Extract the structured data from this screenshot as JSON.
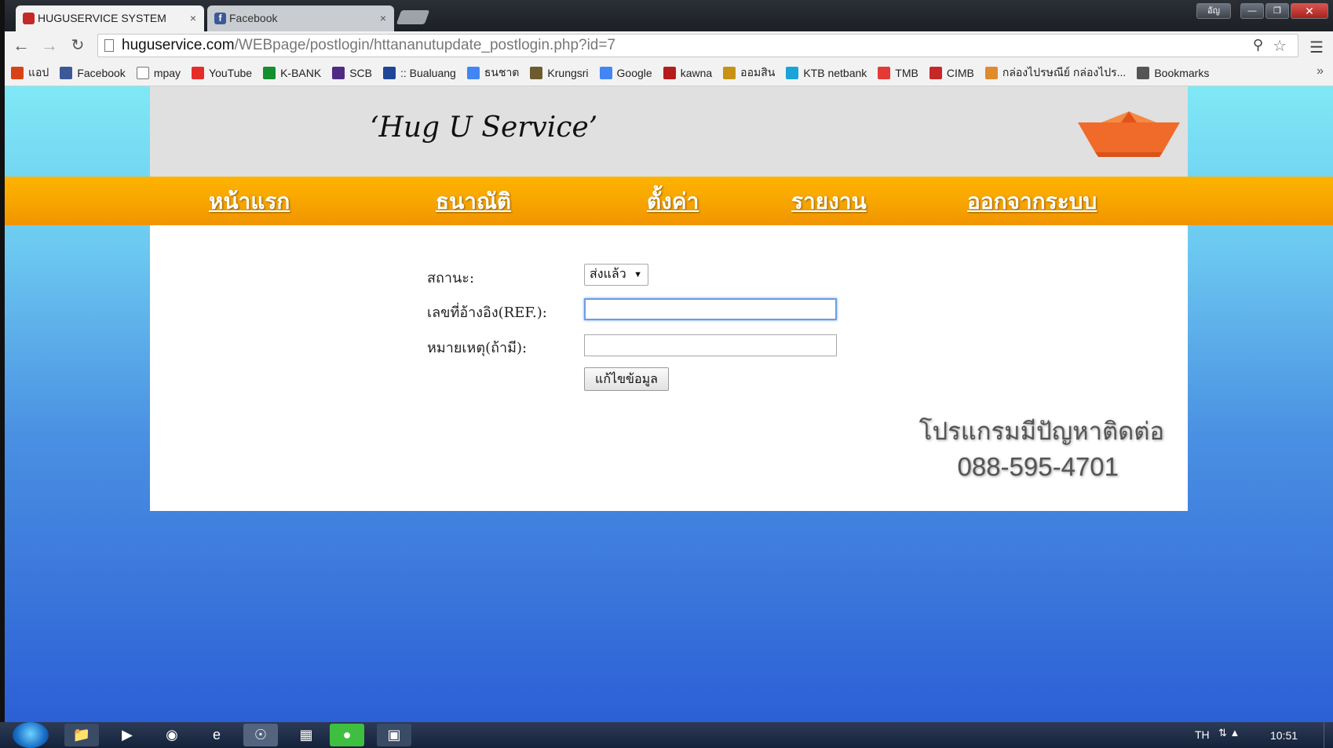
{
  "browser": {
    "tabs": [
      {
        "label": "HUGUSERVICE SYSTEM",
        "active": true
      },
      {
        "label": "Facebook",
        "active": false
      }
    ],
    "tab_close_glyph": "×",
    "window_buttons": {
      "profile": "อัญ",
      "minimize": "—",
      "maximize": "❐",
      "close": "✕"
    },
    "url_domain": "huguservice.com",
    "url_path": "/WEBpage/postlogin/httananutupdate_postlogin.php?id=7",
    "nav": {
      "back": "←",
      "forward": "→",
      "reload": "↻"
    },
    "bookmarks": [
      {
        "label": "แอป",
        "icon": "apps-icon",
        "color": "#d84315"
      },
      {
        "label": "Facebook",
        "icon": "facebook-icon",
        "color": "#3b5998"
      },
      {
        "label": "mpay",
        "icon": "page-icon",
        "color": "#ffffff"
      },
      {
        "label": "YouTube",
        "icon": "youtube-icon",
        "color": "#e52d27"
      },
      {
        "label": "K-BANK",
        "icon": "kbank-icon",
        "color": "#138f2d"
      },
      {
        "label": "SCB",
        "icon": "scb-icon",
        "color": "#4e2a84"
      },
      {
        "label": ":: Bualuang",
        "icon": "bualuang-icon",
        "color": "#1e4598"
      },
      {
        "label": "ธนชาต",
        "icon": "google-icon",
        "color": "#4285f4"
      },
      {
        "label": "Krungsri",
        "icon": "krungsri-icon",
        "color": "#6d5b2f"
      },
      {
        "label": "Google",
        "icon": "google-icon",
        "color": "#4285f4"
      },
      {
        "label": "kawna",
        "icon": "kawna-icon",
        "color": "#b71c1c"
      },
      {
        "label": "ออมสิน",
        "icon": "gsb-icon",
        "color": "#c69214"
      },
      {
        "label": "KTB netbank",
        "icon": "ktb-icon",
        "color": "#1aa3d9"
      },
      {
        "label": "TMB",
        "icon": "tmb-icon",
        "color": "#e53935"
      },
      {
        "label": "CIMB",
        "icon": "cimb-icon",
        "color": "#c62828"
      },
      {
        "label": "กล่องไปรษณีย์ กล่องไปร...",
        "icon": "box-icon",
        "color": "#e08a2c"
      },
      {
        "label": "Bookmarks",
        "icon": "star-icon",
        "color": "#555555"
      }
    ],
    "bookmarks_more": "»"
  },
  "site": {
    "title": "‘Hug U Service’",
    "nav": [
      "หน้าแรก",
      "ธนาณัติ",
      "ตั้งค่า",
      "รายงาน",
      "ออกจากระบบ"
    ],
    "form": {
      "status_label": "สถานะ:",
      "status_value": "ส่งแล้ว",
      "ref_label": "เลขที่อ้างอิง(REF.):",
      "ref_value": "",
      "note_label": "หมายเหตุ(ถ้ามี):",
      "note_value": "",
      "submit_label": "แก้ไขข้อมูล"
    },
    "help_text": "โปรแกรมมีปัญหาติดต่อ",
    "help_phone": "088-595-4701"
  },
  "taskbar": {
    "language": "TH",
    "time": "10:51"
  },
  "colors": {
    "nav_bar": "#f7a600",
    "banner": "#e0e0e0",
    "bg_top": "#7fe8f5",
    "bg_bottom": "#2c5fd6"
  }
}
